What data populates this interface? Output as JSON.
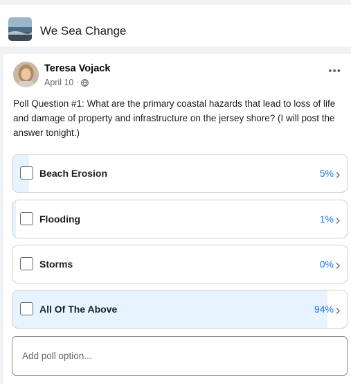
{
  "group": {
    "title": "We Sea Change",
    "thumbnail_icon": "beach-photo-thumbnail"
  },
  "post": {
    "author": "Teresa Vojack",
    "date": "April 10 · ",
    "privacy_icon": "globe-icon",
    "more_icon": "more-icon",
    "more_label": "•••",
    "question": "Poll Question #1: What are the primary coastal hazards that lead to loss of life and damage of property and infrastructure on the jersey shore? (I will post the answer tonight.)"
  },
  "poll": {
    "options": [
      {
        "label": "Beach Erosion",
        "percent_text": "5%",
        "percent": 5
      },
      {
        "label": "Flooding",
        "percent_text": "1%",
        "percent": 1
      },
      {
        "label": "Storms",
        "percent_text": "0%",
        "percent": 0
      },
      {
        "label": "All Of The Above",
        "percent_text": "94%",
        "percent": 94
      }
    ],
    "add_option_placeholder": "Add poll option..."
  },
  "colors": {
    "accent": "#1877f2",
    "fill": "#e7f3ff"
  }
}
